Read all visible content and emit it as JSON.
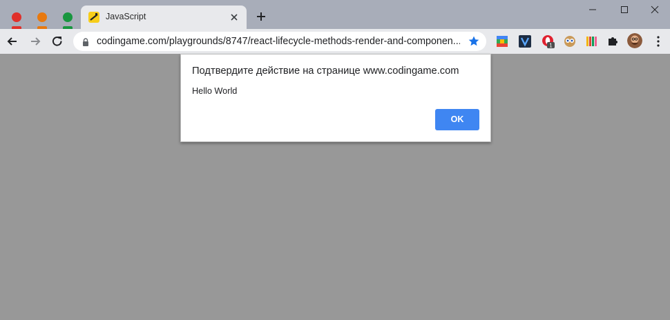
{
  "window": {
    "controls": {
      "minimize_icon": "minimize-icon",
      "maximize_icon": "maximize-icon",
      "close_icon": "close-icon"
    },
    "traffic_lights": [
      "#e0302b",
      "#e8790f",
      "#18963f"
    ]
  },
  "tab": {
    "title": "JavaScript",
    "favicon": "javascript-favicon"
  },
  "toolbar": {
    "url": "codingame.com/playgrounds/8747/react-lifecycle-methods-render-and-componen...",
    "bookmark_icon": "star-icon",
    "extensions": [
      "google-apps-icon",
      "v-extension-icon",
      "opera-extension-icon",
      "owl-extension-icon",
      "color-bars-extension-icon",
      "puzzle-icon"
    ],
    "extension_badge": "1"
  },
  "dialog": {
    "title": "Подтвердите действие на странице www.codingame.com",
    "message": "Hello World",
    "ok_label": "OK"
  },
  "colors": {
    "accent": "#3f86f2",
    "page_background": "#989898",
    "titlebar_background": "#a8adb9",
    "toolbar_background": "#e8e9ec"
  }
}
